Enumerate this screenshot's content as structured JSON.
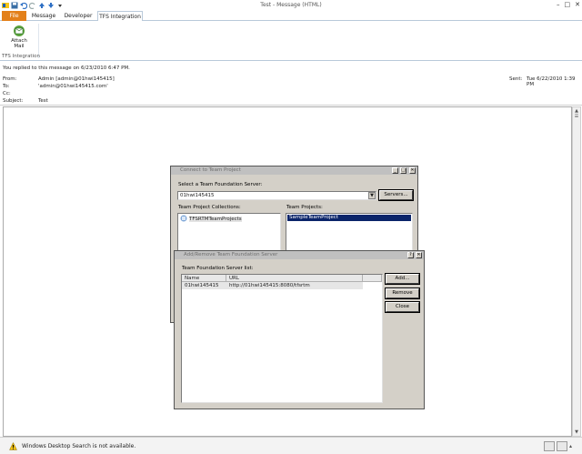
{
  "window": {
    "title": "Test - Message (HTML)"
  },
  "tabs": [
    {
      "label": "File"
    },
    {
      "label": "Message"
    },
    {
      "label": "Developer"
    },
    {
      "label": "TFS Integration"
    }
  ],
  "ribbon": {
    "attach_label": "Attach Mail",
    "group_label": "TFS Integration"
  },
  "header": {
    "info_bar": "You replied to this message on 6/23/2010 6:47 PM.",
    "from_label": "From:",
    "from_value": "Admin [admin@01hwi145415]",
    "to_label": "To:",
    "to_value": "'admin@01hwi145415.com'",
    "cc_label": "Cc:",
    "subject_label": "Subject:",
    "subject_value": "Test",
    "sent_label": "Sent:",
    "sent_value": "Tue 6/22/2010 1:39 PM"
  },
  "connect_dialog": {
    "title": "Connect to Team Project",
    "server_label": "Select a Team Foundation Server:",
    "server_value": "01hwi145415",
    "servers_button": "Servers...",
    "collections_label": "Team Project Collections:",
    "collections": [
      "TFSRTMTeamProjects"
    ],
    "projects_label": "Team Projects:",
    "projects": [
      "SampleTeamProject"
    ]
  },
  "addremove_dialog": {
    "title": "Add/Remove Team Foundation Server",
    "list_label": "Team Foundation Server list:",
    "columns": [
      "Name",
      "URL"
    ],
    "rows": [
      {
        "name": "01hwi145415",
        "url": "http://01hwi145415:8080/tfsrtm"
      }
    ],
    "add_button": "Add...",
    "remove_button": "Remove",
    "close_button": "Close"
  },
  "status": {
    "text": "Windows Desktop Search is not available."
  },
  "colors": {
    "file_tab": "#e3801a",
    "selected_row": "#0a246a",
    "dialog_face": "#d4d0c8"
  }
}
